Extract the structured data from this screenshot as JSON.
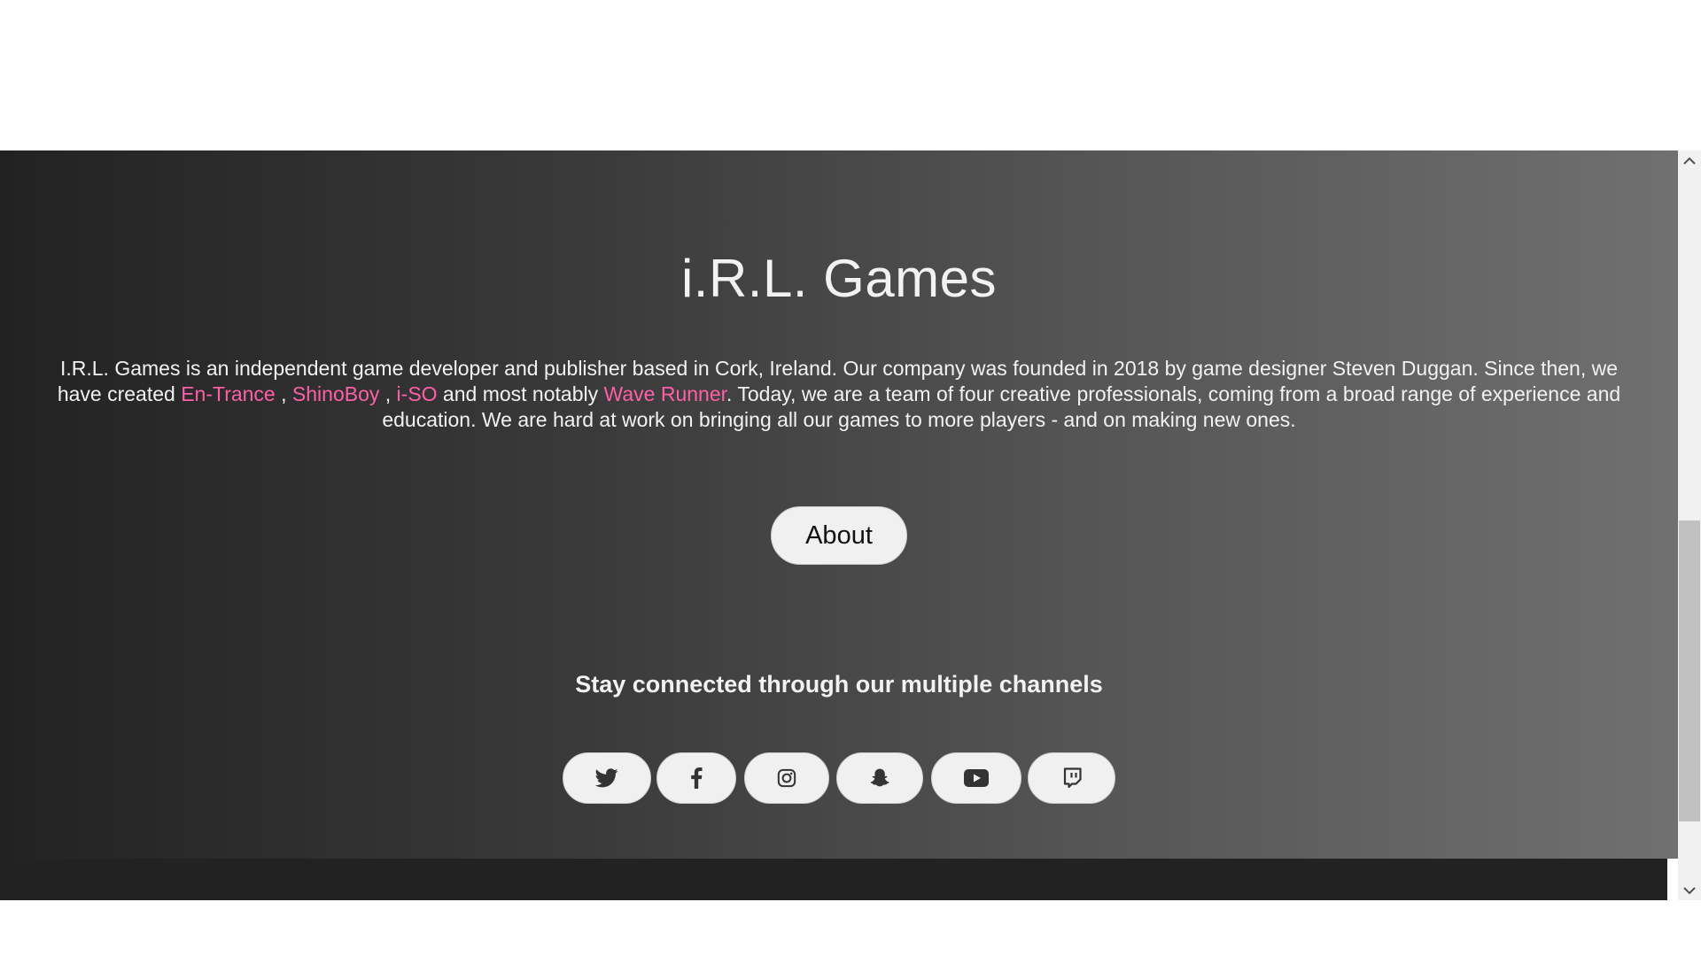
{
  "hero": {
    "title": "i.R.L. Games",
    "intro": {
      "text_1": "I.R.L. Games is an independent game developer and publisher based in Cork, Ireland. Our company was founded in 2018 by game designer Steven Duggan. Since then, we have created ",
      "link_1": "En-Trance",
      "sep_1": " , ",
      "link_2": "ShinoBoy",
      "sep_2": " , ",
      "link_3": "i-SO",
      "text_2": " and most notably ",
      "link_4": "Wave Runner",
      "text_3": ". Today, we are a team of four creative professionals, coming from a broad range of experience and education. We are hard at work on bringing all our games to more players - and on making new ones."
    },
    "about_button": "About",
    "social_heading": "Stay connected through our multiple channels",
    "link_color": "#ff5fa8"
  },
  "social": [
    {
      "icon": "twitter-icon"
    },
    {
      "icon": "facebook-icon"
    },
    {
      "icon": "instagram-icon"
    },
    {
      "icon": "snapchat-icon"
    },
    {
      "icon": "youtube-icon"
    },
    {
      "icon": "twitch-icon"
    }
  ]
}
